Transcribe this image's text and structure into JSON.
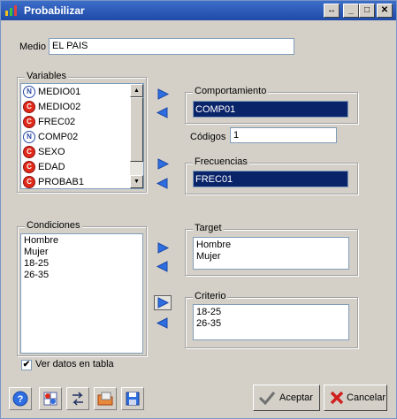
{
  "window": {
    "title": "Probabilizar"
  },
  "medio": {
    "label": "Medio",
    "value": "EL PAIS"
  },
  "variables": {
    "title": "Variables",
    "items": [
      {
        "icon": "N",
        "label": "MEDIO01"
      },
      {
        "icon": "C",
        "label": "MEDIO02"
      },
      {
        "icon": "C",
        "label": "FREC02"
      },
      {
        "icon": "N",
        "label": "COMP02"
      },
      {
        "icon": "C",
        "label": "SEXO"
      },
      {
        "icon": "C",
        "label": "EDAD"
      },
      {
        "icon": "C",
        "label": "PROBAB1"
      }
    ]
  },
  "comportamiento": {
    "title": "Comportamiento",
    "value": "COMP01"
  },
  "codigos": {
    "label": "Códigos",
    "value": "1"
  },
  "frecuencias": {
    "title": "Frecuencias",
    "value": "FREC01"
  },
  "condiciones": {
    "title": "Condiciones",
    "items": [
      "Hombre",
      "Mujer",
      "18-25",
      "26-35"
    ]
  },
  "target": {
    "title": "Target",
    "items": [
      "Hombre",
      "Mujer"
    ]
  },
  "criterio": {
    "title": "Criterio",
    "items": [
      "18-25",
      "26-35"
    ]
  },
  "ver_datos": {
    "label": "Ver datos en tabla",
    "checked": true
  },
  "buttons": {
    "accept": "Aceptar",
    "cancel": "Cancelar"
  }
}
